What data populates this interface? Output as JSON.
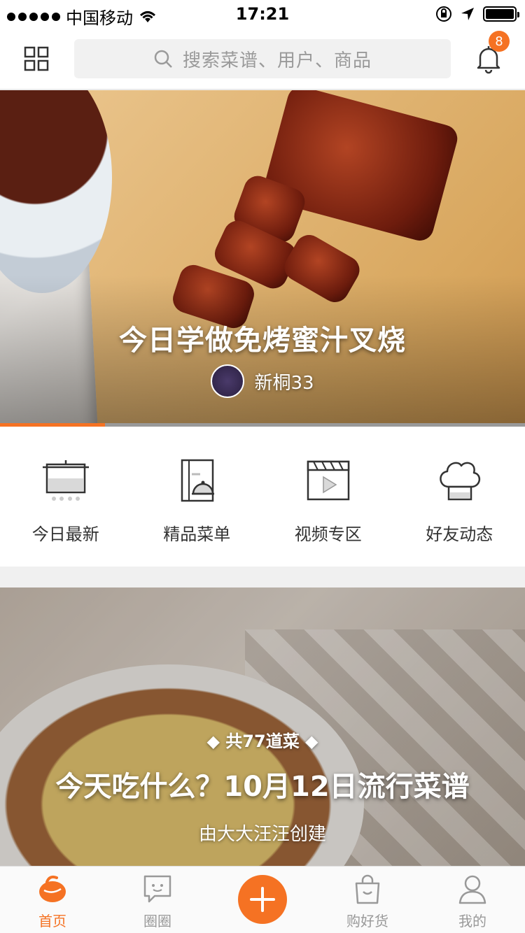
{
  "status_bar": {
    "carrier": "中国移动",
    "time": "17:21"
  },
  "header": {
    "search_placeholder": "搜索菜谱、用户、商品",
    "notification_count": "8"
  },
  "hero": {
    "title": "今日学做免烤蜜汁叉烧",
    "author": "新桐33",
    "carousel_progress": 0.2
  },
  "categories": [
    {
      "label": "今日最新",
      "icon": "pot-icon"
    },
    {
      "label": "精品菜单",
      "icon": "menu-book-icon"
    },
    {
      "label": "视频专区",
      "icon": "video-clapper-icon"
    },
    {
      "label": "好友动态",
      "icon": "chef-hat-icon"
    }
  ],
  "feature": {
    "count": "共77道菜",
    "title": "今天吃什么？10月12日流行菜谱",
    "creator": "由大大汪汪创建"
  },
  "tabbar": {
    "items": [
      {
        "label": "首页",
        "icon": "home-icon",
        "active": true
      },
      {
        "label": "圈圈",
        "icon": "chat-icon",
        "active": false
      },
      {
        "label": "",
        "icon": "add-icon",
        "active": false
      },
      {
        "label": "购好货",
        "icon": "shopping-bag-icon",
        "active": false
      },
      {
        "label": "我的",
        "icon": "user-icon",
        "active": false
      }
    ]
  },
  "colors": {
    "accent": "#f57223"
  }
}
